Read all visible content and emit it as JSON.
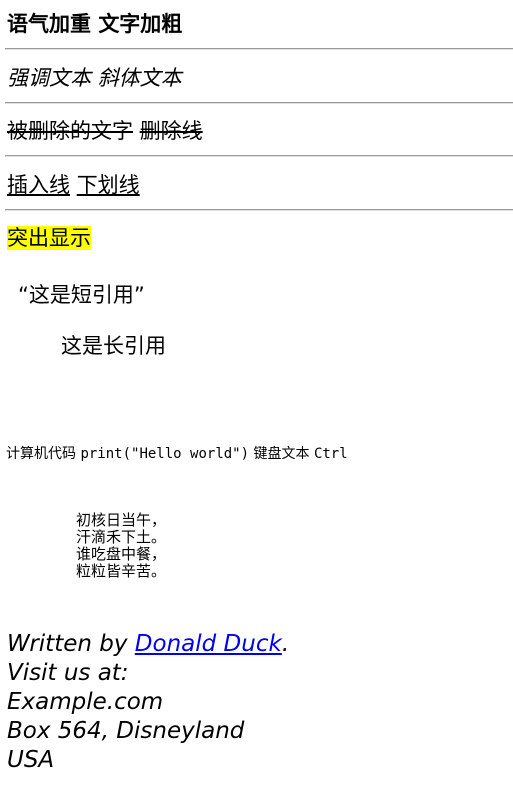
{
  "strong": {
    "text": "语气加重",
    "b_text": "文字加粗"
  },
  "emphasis": {
    "text": "强调文本",
    "i_text": "斜体文本"
  },
  "deleted": {
    "text": "被删除的文字",
    "s_text": "删除线"
  },
  "inserted": {
    "text": "插入线",
    "u_text": "下划线"
  },
  "mark": {
    "text": "突出显示"
  },
  "short_quote": {
    "text": "“这是短引用”"
  },
  "long_quote": {
    "text": "这是长引用"
  },
  "code_line": {
    "prefix": "计算机代码",
    "code": "print(\"Hello world\")",
    "kbd_label": "键盘文本",
    "kbd": "Ctrl"
  },
  "poem": {
    "lines": [
      "初核日当午，",
      "汗滴禾下土。",
      "谁吃盘中餐，",
      "粒粒皆辛苦。"
    ]
  },
  "address": {
    "written_by": "Written by",
    "author": "Donald Duck",
    "period": ".",
    "visit": "Visit us at:",
    "site": "Example.com",
    "box": "Box 564, Disneyland",
    "country": "USA"
  },
  "colors": {
    "mark": "#ffff00",
    "link": "#0000ee"
  }
}
